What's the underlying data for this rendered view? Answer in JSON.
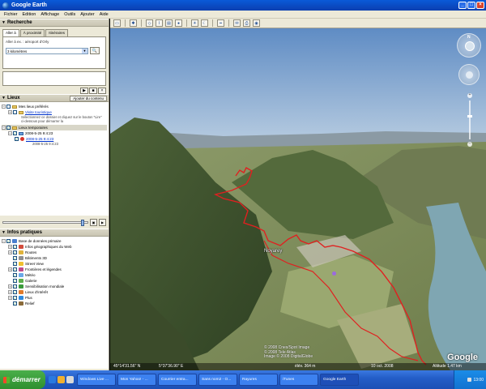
{
  "window": {
    "title": "Google Earth"
  },
  "menu": [
    "Fichier",
    "Edition",
    "Affichage",
    "Outils",
    "Ajouter",
    "Aide"
  ],
  "search": {
    "header": "Recherche",
    "tabs": [
      "Aller à",
      "À proximité",
      "Itinéraires"
    ],
    "fly_label": "Aller à ex. : aéroport d'Orly",
    "fly_value": "3 kilomètres"
  },
  "places": {
    "header": "Lieux",
    "add_content": "Ajouter du contenu",
    "items": [
      {
        "label": "Mes lieux préférés"
      },
      {
        "label": "Visite touristique",
        "link": true
      },
      {
        "label": "Sélectionnez ce dossier et cliquez sur le bouton \"Lire\" ci-dessous pour démarrer la"
      },
      {
        "label": "Lieux temporaires"
      },
      {
        "label": "2008-5-25 9:4:23"
      },
      {
        "label": "2008-5-25 9:4:23",
        "link": true
      },
      {
        "label": "2008-5-25 9:4:23"
      }
    ]
  },
  "layers": {
    "header": "Infos pratiques",
    "items": [
      {
        "label": "Base de données primaire",
        "color": "#4a7fd0"
      },
      {
        "label": "Infos géographiques du Web",
        "color": "#d24c3c"
      },
      {
        "label": "Routes",
        "color": "#e0b33c"
      },
      {
        "label": "Bâtiments 3D",
        "color": "#8f8f8f"
      },
      {
        "label": "Street View",
        "color": "#f0c030"
      },
      {
        "label": "Frontières et légendes",
        "color": "#c04a8a"
      },
      {
        "label": "Météo",
        "color": "#6aa8e8"
      },
      {
        "label": "Galerie",
        "color": "#5bb04b"
      },
      {
        "label": "Sensibilisation mondiale",
        "color": "#3a9a3a"
      },
      {
        "label": "Lieux d'intérêt",
        "color": "#e07a2a"
      },
      {
        "label": "Plus",
        "color": "#2e8be0"
      },
      {
        "label": "Relief",
        "color": "#8a6a3a"
      }
    ]
  },
  "viewport": {
    "place_label": "Noyarey",
    "copyright_lines": [
      "© 2008 Cnes/Spot Image",
      "© 2008 Tele Atlas",
      "Image © 2008 DigitalGlobe"
    ],
    "logo": "Google",
    "status": {
      "coords": "45°14'31.56\" N",
      "coords_lon": "5°37'36.90\" E",
      "elev": "élév. 364 m",
      "date": "10 oct. 2008",
      "altitude": "Altitude 1.47 km"
    }
  },
  "taskbar": {
    "start": "démarrer",
    "tasks": [
      "Windows Live ...",
      "Mon Yahoo! - ...",
      "Courrier entra...",
      "Sans nom2 - O...",
      "Rayures",
      "iTunes",
      "Google Earth"
    ],
    "clock": "13:00"
  }
}
